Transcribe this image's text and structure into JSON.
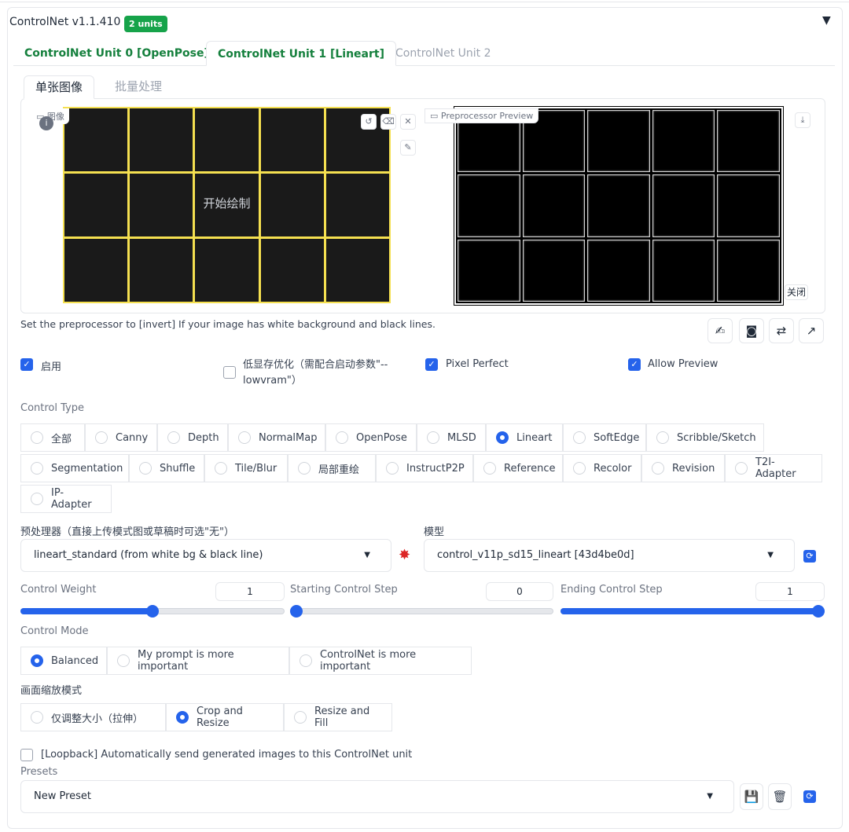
{
  "header": {
    "title": "ControlNet v1.1.410",
    "units_badge": "2 units",
    "collapse_icon": "triangle-down-icon"
  },
  "unit_tabs": [
    {
      "label": "ControlNet Unit 0 [OpenPose]",
      "active": false
    },
    {
      "label": "ControlNet Unit 1 [Lineart]",
      "active": true
    },
    {
      "label": "ControlNet Unit 2",
      "active": false
    }
  ],
  "image_tabs": [
    {
      "label": "单张图像",
      "active": true
    },
    {
      "label": "批量处理",
      "active": false
    }
  ],
  "image_panel": {
    "input_label": "图像",
    "draw_hint": "开始绘制",
    "preview_label": "Preprocessor Preview",
    "close_label": "关闭",
    "canvas_line_color": "#f5e050"
  },
  "hint_text": "Set the preprocessor to [invert] If your image has white background and black lines.",
  "checkboxes": {
    "enable": {
      "label": "启用",
      "checked": true
    },
    "low_vram": {
      "label": "低显存优化（需配合启动参数\"--lowvram\"）",
      "checked": false
    },
    "pixel_perfect": {
      "label": "Pixel Perfect",
      "checked": true
    },
    "allow_preview": {
      "label": "Allow Preview",
      "checked": true
    }
  },
  "control_type": {
    "label": "Control Type",
    "row1": [
      "全部",
      "Canny",
      "Depth",
      "NormalMap",
      "OpenPose",
      "MLSD",
      "Lineart",
      "SoftEdge",
      "Scribble/Sketch"
    ],
    "row2": [
      "Segmentation",
      "Shuffle",
      "Tile/Blur",
      "局部重绘",
      "InstructP2P",
      "Reference",
      "Recolor",
      "Revision",
      "T2I-Adapter"
    ],
    "row3": [
      "IP-Adapter"
    ],
    "selected": "Lineart"
  },
  "preprocessor": {
    "label": "预处理器（直接上传模式图或草稿时可选\"无\"）",
    "value": "lineart_standard (from white bg & black line)"
  },
  "model": {
    "label": "模型",
    "value": "control_v11p_sd15_lineart [43d4be0d]"
  },
  "sliders": {
    "weight": {
      "label": "Control Weight",
      "value": "1",
      "fraction": 0.5
    },
    "start": {
      "label": "Starting Control Step",
      "value": "0",
      "fraction": 0.0
    },
    "end": {
      "label": "Ending Control Step",
      "value": "1",
      "fraction": 1.0
    }
  },
  "control_mode": {
    "label": "Control Mode",
    "options": [
      "Balanced",
      "My prompt is more important",
      "ControlNet is more important"
    ],
    "selected": "Balanced"
  },
  "resize_mode": {
    "label": "画面缩放模式",
    "options": [
      "仅调整大小（拉伸）",
      "Crop and Resize",
      "Resize and Fill"
    ],
    "selected": "Crop and Resize"
  },
  "loopback": {
    "label": "[Loopback] Automatically send generated images to this ControlNet unit",
    "checked": false
  },
  "presets": {
    "label": "Presets",
    "value": "New Preset"
  },
  "colors": {
    "accent": "#2563eb",
    "badge": "#16a34a",
    "tab_green": "#15803d"
  }
}
